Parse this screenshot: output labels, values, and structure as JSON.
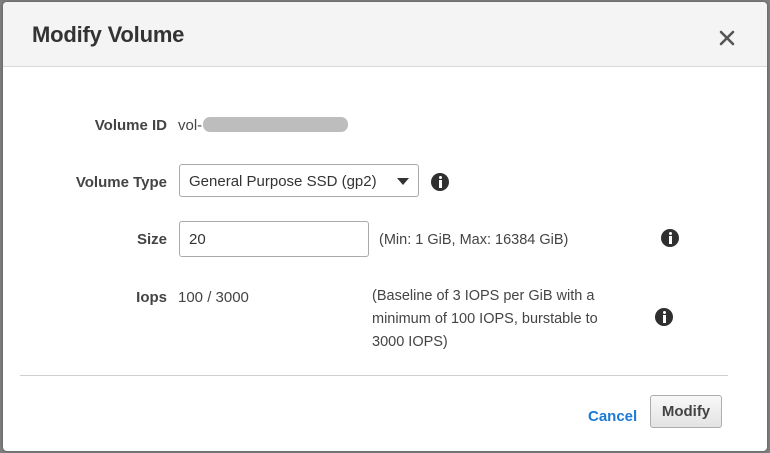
{
  "dialog": {
    "title": "Modify Volume",
    "close_icon": "close-icon"
  },
  "volume_id": {
    "label": "Volume ID",
    "value_prefix": "vol-"
  },
  "volume_type": {
    "label": "Volume Type",
    "selected": "General Purpose SSD (gp2)",
    "info_icon": "info-icon"
  },
  "size": {
    "label": "Size",
    "value": "20",
    "hint": "(Min: 1 GiB, Max: 16384 GiB)",
    "info_icon": "info-icon"
  },
  "iops": {
    "label": "Iops",
    "value": "100 / 3000",
    "hint_lines": [
      "(Baseline of 3 IOPS per GiB with a",
      "minimum of 100 IOPS, burstable to",
      "3000 IOPS)"
    ],
    "info_icon": "info-icon"
  },
  "footer": {
    "cancel_label": "Cancel",
    "modify_label": "Modify"
  },
  "colors": {
    "link": "#1a7ad6",
    "header_bg": "#f4f4f4"
  }
}
